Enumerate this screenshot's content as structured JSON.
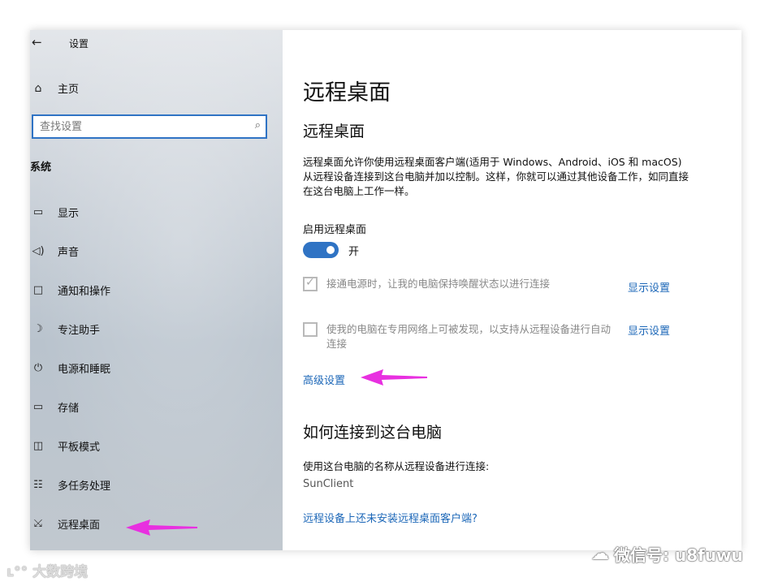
{
  "window": {
    "title": "设置"
  },
  "sidebar": {
    "home_label": "主页",
    "search_placeholder": "查找设置",
    "section_label": "系统",
    "items": [
      {
        "label": "显示",
        "icon": "monitor-icon"
      },
      {
        "label": "声音",
        "icon": "speaker-icon"
      },
      {
        "label": "通知和操作",
        "icon": "notification-icon"
      },
      {
        "label": "专注助手",
        "icon": "moon-icon"
      },
      {
        "label": "电源和睡眠",
        "icon": "power-icon"
      },
      {
        "label": "存储",
        "icon": "storage-icon"
      },
      {
        "label": "平板模式",
        "icon": "tablet-icon"
      },
      {
        "label": "多任务处理",
        "icon": "multitask-icon"
      },
      {
        "label": "远程桌面",
        "icon": "remote-desktop-icon"
      }
    ]
  },
  "main": {
    "page_title": "远程桌面",
    "sub_title": "远程桌面",
    "description": "远程桌面允许你使用远程桌面客户端(适用于 Windows、Android、iOS 和 macOS)从远程设备连接到这台电脑并加以控制。这样，你就可以通过其他设备工作，如同直接在这台电脑上工作一样。",
    "enable_label": "启用远程桌面",
    "toggle_state": "开",
    "toggle_on": true,
    "checkbox1": {
      "label": "接通电源时，让我的电脑保持唤醒状态以进行连接",
      "checked": true,
      "link": "显示设置"
    },
    "checkbox2": {
      "label": "使我的电脑在专用网络上可被发现，以支持从远程设备进行自动连接",
      "checked": false,
      "link": "显示设置"
    },
    "advanced_link": "高级设置",
    "how_to_title": "如何连接到这台电脑",
    "how_to_text": "使用这台电脑的名称从远程设备进行连接:",
    "pc_name": "SunClient",
    "client_link": "远程设备上还未安装远程桌面客户端?"
  },
  "watermarks": {
    "left": "大数跨境",
    "right": "微信号: u8fuwu"
  },
  "colors": {
    "accent": "#2f73c4",
    "link": "#1c67b8",
    "annotation_arrow": "#e830e0"
  }
}
